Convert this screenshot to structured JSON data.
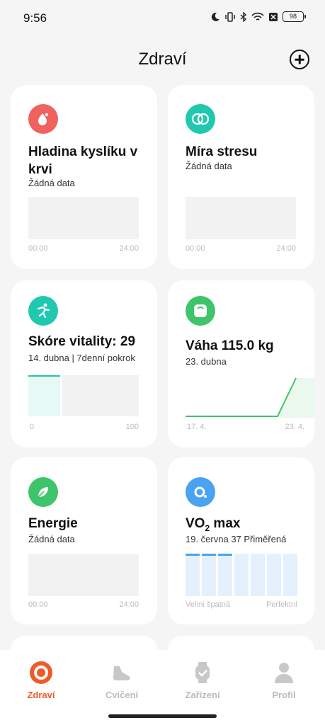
{
  "status": {
    "time": "9:56",
    "battery": "98"
  },
  "header": {
    "title": "Zdraví"
  },
  "cards": {
    "oxygen": {
      "title": "Hladina kyslíku v krvi",
      "subtitle": "Žádná data",
      "axis_start": "00:00",
      "axis_end": "24:00"
    },
    "stress": {
      "title": "Míra stresu",
      "subtitle": "Žádná data",
      "axis_start": "00:00",
      "axis_end": "24:00"
    },
    "vitality": {
      "title": "Skóre vitality: 29",
      "subtitle": "14. dubna | 7denní pokrok",
      "axis_start": "0",
      "axis_end": "100",
      "progress_fraction": 0.29
    },
    "weight": {
      "title": "Váha 115.0 kg",
      "subtitle": "23. dubna",
      "axis_start": "17. 4.",
      "axis_end": "23. 4."
    },
    "energy": {
      "title": "Energie",
      "subtitle": "Žádná data",
      "axis_start": "00:00",
      "axis_end": "24:00"
    },
    "vo2": {
      "title_main": "VO",
      "title_sub": "2",
      "title_rest": " max",
      "subtitle": "19. června 37 Přiměřená",
      "axis_start": "Velmi špatná",
      "axis_end": "Perfektní",
      "level_bars": 3,
      "total_bars": 7
    }
  },
  "tabs": [
    {
      "label": "Zdraví",
      "active": true
    },
    {
      "label": "Cvičení",
      "active": false
    },
    {
      "label": "Zařízení",
      "active": false
    },
    {
      "label": "Profil",
      "active": false
    }
  ],
  "colors": {
    "accent": "#f05a28",
    "oxygen": "#f06260",
    "teal": "#21c8b0",
    "green": "#3ec46a",
    "blue": "#4aa3f0"
  }
}
